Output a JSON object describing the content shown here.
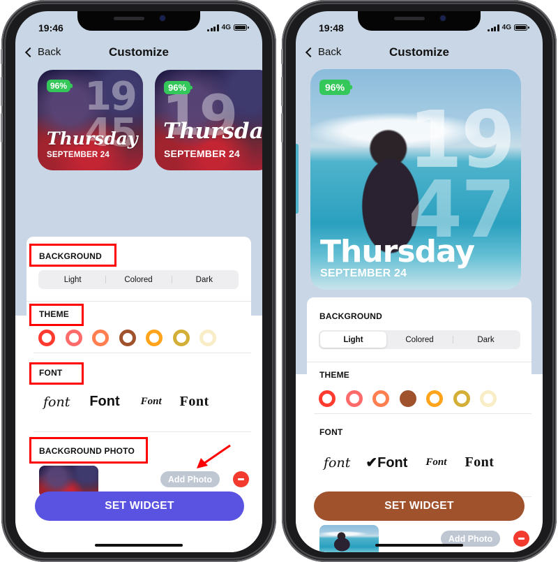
{
  "colors": {
    "screen_bg": "#c9d6e5",
    "highlight": "#ff0000",
    "battery_green": "#34c759",
    "remove_red": "#f23a2f",
    "add_photo_bg": "#bfc7d3"
  },
  "screens": [
    {
      "status": {
        "time": "19:46",
        "network": "4G"
      },
      "nav": {
        "back_label": "Back",
        "title": "Customize"
      },
      "widgets": [
        {
          "battery": "96%",
          "hour": "19",
          "minute": "45",
          "day": "Thursday",
          "date": "SEPTEMBER 24",
          "style": "script"
        },
        {
          "battery": "96%",
          "hour": "19",
          "minute": ":",
          "day": "Thursday",
          "date": "SEPTEMBER 24",
          "style": "script"
        }
      ],
      "sections": {
        "background": {
          "label": "BACKGROUND",
          "options": [
            "Light",
            "Colored",
            "Dark"
          ],
          "selected": null
        },
        "theme": {
          "label": "THEME",
          "swatches": [
            "#ff3b30",
            "#ff6b6b",
            "#ff7f50",
            "#a0522d",
            "#ffa41b",
            "#d4af37",
            "#f8edc6"
          ],
          "selected": null
        },
        "font": {
          "label": "FONT",
          "options": [
            "font",
            "Font",
            "Font",
            "Font"
          ],
          "selected": null
        },
        "background_photo": {
          "label": "BACKGROUND PHOTO",
          "add_label": "Add Photo"
        }
      },
      "set_widget": {
        "label": "SET WIDGET",
        "color": "#5a52e0"
      },
      "annotations": {
        "highlighted_sections": [
          "BACKGROUND",
          "THEME",
          "FONT",
          "BACKGROUND PHOTO"
        ],
        "arrow_target": "Add Photo"
      }
    },
    {
      "status": {
        "time": "19:48",
        "network": "4G"
      },
      "nav": {
        "back_label": "Back",
        "title": "Customize"
      },
      "widgets": [
        {
          "battery": "96%",
          "hour": "19",
          "minute": "47",
          "day": "Thursday",
          "date": "SEPTEMBER 24",
          "style": "bold"
        }
      ],
      "sections": {
        "background": {
          "label": "BACKGROUND",
          "options": [
            "Light",
            "Colored",
            "Dark"
          ],
          "selected": "Light"
        },
        "theme": {
          "label": "THEME",
          "swatches": [
            "#ff3b30",
            "#ff6b6b",
            "#ff7f50",
            "#a0522d",
            "#ffa41b",
            "#d4af37",
            "#f8edc6"
          ],
          "selected": "#a0522d"
        },
        "font": {
          "label": "FONT",
          "options": [
            "font",
            "Font",
            "Font",
            "Font"
          ],
          "selected": 1,
          "check_mark": "✔"
        },
        "background_photo": {
          "add_label": "Add Photo"
        }
      },
      "set_widget": {
        "label": "SET WIDGET",
        "color": "#a0522d"
      }
    }
  ]
}
